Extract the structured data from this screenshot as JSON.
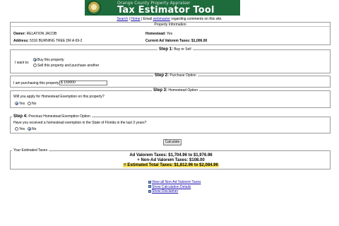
{
  "banner": {
    "subtitle": "Orange County Property Appraiser",
    "title": "Tax Estimator Tool"
  },
  "toplinks": {
    "search": "Search",
    "sep1": " | ",
    "home": "Home",
    "sep2": " | Email ",
    "webmaster": "webmaster",
    "tail": " regarding comments on this site."
  },
  "property": {
    "heading": "Property Information",
    "owner_label": "Owner:",
    "owner_value": "RELATION JACOB",
    "address_label": "Address:",
    "address_value": "5316 BURNING TREE DR A 69-2",
    "homestead_label": "Homestead:",
    "homestead_value": "Yes",
    "adval_label": "Current Ad Valorem Taxes:",
    "adval_value": "$1,006.00"
  },
  "step1": {
    "num": "Step 1:",
    "title": "Buy or Sell",
    "prompt": "I want to:",
    "options": [
      "Buy this property",
      "Sell this property and purchase another"
    ],
    "selected": 0
  },
  "step2": {
    "num": "Step 2:",
    "title": "Purchase Option",
    "prompt": "I am purchasing this property for:",
    "value": "$ 150000"
  },
  "step3": {
    "num": "Step 3:",
    "title": "Homestead Option",
    "question": "Will you apply for Homestead Exemption on this property?",
    "options": [
      "Yes",
      "No"
    ],
    "selected": 0
  },
  "step4": {
    "num": "Step 4:",
    "title": "Previous Homestead Exemption Option",
    "question": "Have you received a homestead exemption in the State of Florida in the last 3 years?",
    "options": [
      "Yes",
      "No"
    ],
    "selected": 1
  },
  "calculate_label": "Calculate",
  "results": {
    "heading": "Your Estimated Taxes",
    "line1": "Ad Valorem Taxes: $1,704.96 to $1,976.96",
    "line2": "+ Non-Ad Valorem Taxes: $108.00",
    "line3": "= Estimated Total Taxes: $1,812.96 to $2,084.96"
  },
  "bottomlinks": [
    "View all Non-Ad Valorem Taxes",
    "Show Calculation Details",
    "Show Disclaimer"
  ],
  "colors": {
    "banner": "#1e6b3c",
    "highlight": "#f6e15a",
    "link": "#1a0dab"
  }
}
